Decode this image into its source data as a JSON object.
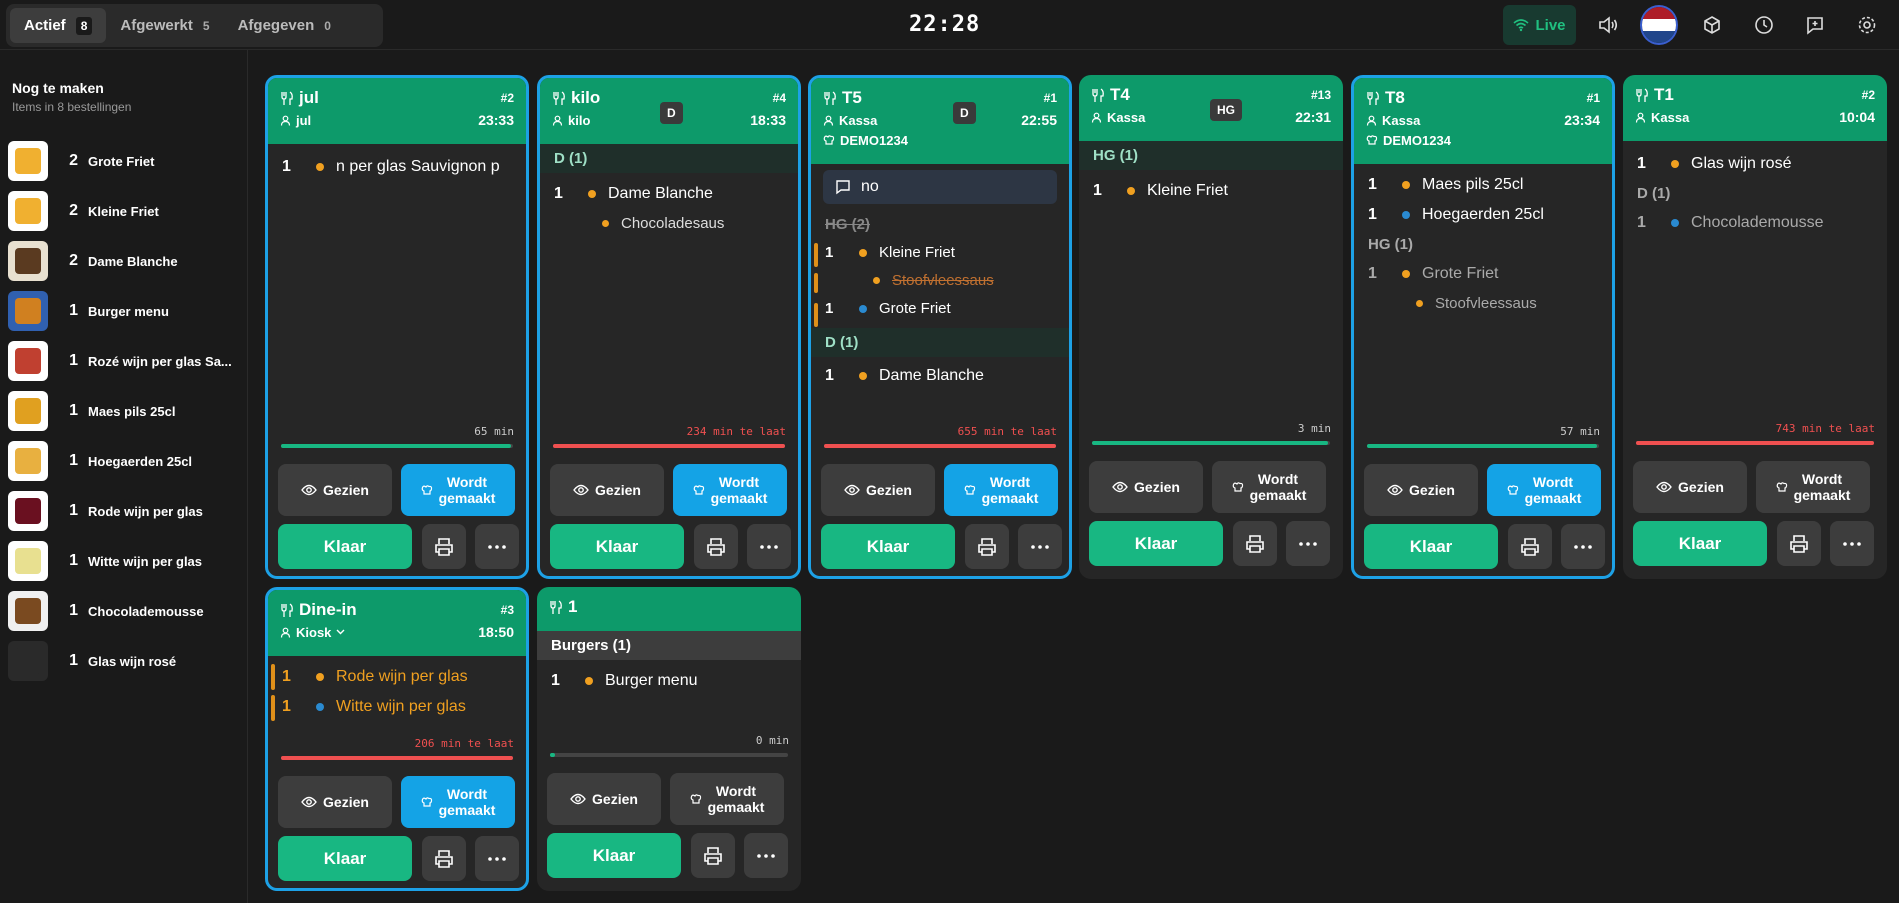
{
  "tabs": [
    {
      "label": "Actief",
      "count": "8"
    },
    {
      "label": "Afgewerkt",
      "count": "5"
    },
    {
      "label": "Afgegeven",
      "count": "0"
    }
  ],
  "clock": "22:28",
  "live": "Live",
  "sidebar": {
    "title": "Nog te maken",
    "subtitle": "Items in 8 bestellingen",
    "items": [
      {
        "qty": "2",
        "name": "Grote Friet"
      },
      {
        "qty": "2",
        "name": "Kleine Friet"
      },
      {
        "qty": "2",
        "name": "Dame Blanche"
      },
      {
        "qty": "1",
        "name": "Burger menu"
      },
      {
        "qty": "1",
        "name": "Rozé wijn per glas Sa..."
      },
      {
        "qty": "1",
        "name": "Maes pils 25cl"
      },
      {
        "qty": "1",
        "name": "Hoegaerden 25cl"
      },
      {
        "qty": "1",
        "name": "Rode wijn per glas"
      },
      {
        "qty": "1",
        "name": "Witte wijn per glas"
      },
      {
        "qty": "1",
        "name": "Chocolademousse"
      },
      {
        "qty": "1",
        "name": "Glas wijn rosé"
      }
    ]
  },
  "labels": {
    "gezien": "Gezien",
    "wordt": "Wordt",
    "gemaakt": "gemaakt",
    "klaar": "Klaar"
  },
  "orders": [
    {
      "name": "jul",
      "num": "#2",
      "user": "jul",
      "time": "23:33",
      "timer": "65 min",
      "l1q": "1",
      "l1": "n per glas Sauvignon p"
    },
    {
      "name": "kilo",
      "num": "#4",
      "user": "kilo",
      "time": "18:33",
      "badge": "D",
      "timer": "234 min te laat",
      "sec": "D (1)",
      "l1q": "1",
      "l1": "Dame Blanche",
      "s1": "Chocoladesaus"
    },
    {
      "name": "T5",
      "num": "#1",
      "user": "Kassa",
      "time": "22:55",
      "badge": "D",
      "ref": "DEMO1234",
      "note": "no",
      "sec": "HG (2)",
      "l1q": "1",
      "l1": "Kleine Friet",
      "s1": "Stoofvleessaus",
      "l2q": "1",
      "l2": "Grote Friet",
      "sec2": "D (1)",
      "l3q": "1",
      "l3": "Dame Blanche",
      "timer": "655 min te laat"
    },
    {
      "name": "T4",
      "num": "#13",
      "user": "Kassa",
      "time": "22:31",
      "badge": "HG",
      "sec": "HG (1)",
      "l1q": "1",
      "l1": "Kleine Friet",
      "timer": "3 min"
    },
    {
      "name": "T8",
      "num": "#1",
      "user": "Kassa",
      "time": "23:34",
      "ref": "DEMO1234",
      "l1q": "1",
      "l1": "Maes pils 25cl",
      "l2q": "1",
      "l2": "Hoegaerden 25cl",
      "sec": "HG (1)",
      "l3q": "1",
      "l3": "Grote Friet",
      "s1": "Stoofvleessaus",
      "timer": "57 min"
    },
    {
      "name": "T1",
      "num": "#2",
      "user": "Kassa",
      "time": "10:04",
      "l1q": "1",
      "l1": "Glas wijn rosé",
      "sec": "D (1)",
      "l2q": "1",
      "l2": "Chocolademousse",
      "timer": "743 min te laat"
    },
    {
      "name": "Dine-in",
      "num": "#3",
      "user": "Kiosk",
      "time": "18:50",
      "l1q": "1",
      "l1": "Rode wijn per glas",
      "l2q": "1",
      "l2": "Witte wijn per glas",
      "timer": "206 min te laat"
    },
    {
      "name": "1",
      "sec": "Burgers (1)",
      "l1q": "1",
      "l1": "Burger menu",
      "timer": "0 min"
    }
  ]
}
